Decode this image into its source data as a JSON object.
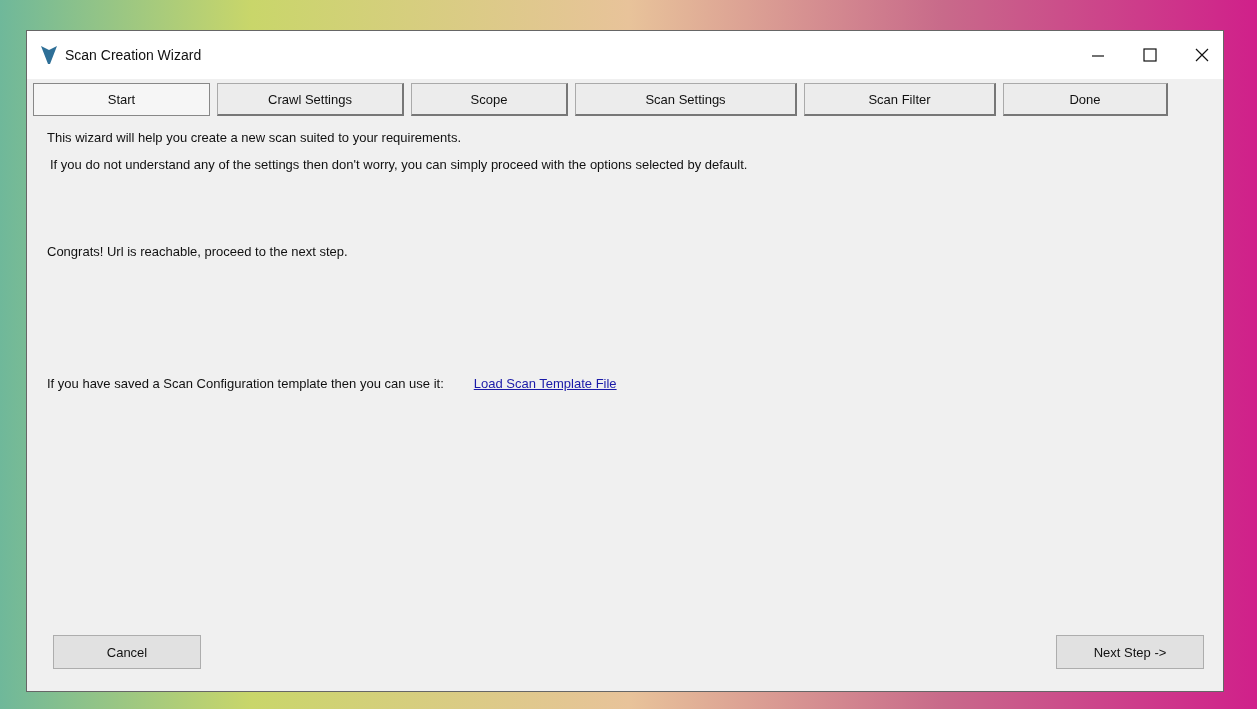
{
  "window": {
    "title": "Scan Creation Wizard"
  },
  "tabs": [
    {
      "label": "Start",
      "selected": true
    },
    {
      "label": "Crawl Settings",
      "selected": false
    },
    {
      "label": "Scope",
      "selected": false
    },
    {
      "label": "Scan Settings",
      "selected": false
    },
    {
      "label": "Scan Filter",
      "selected": false
    },
    {
      "label": "Done",
      "selected": false
    }
  ],
  "intro": [
    "This wizard will help you create a new scan suited to your requirements.",
    "If you do not understand any of the settings then don't worry, you can simply proceed with the options selected by default."
  ],
  "status": "Congrats! Url is reachable, proceed to the next step.",
  "template": {
    "text": "If you have saved a Scan Configuration template then you can use it:",
    "link": "Load Scan Template File"
  },
  "buttons": {
    "cancel": "Cancel",
    "next": "Next Step ->"
  }
}
